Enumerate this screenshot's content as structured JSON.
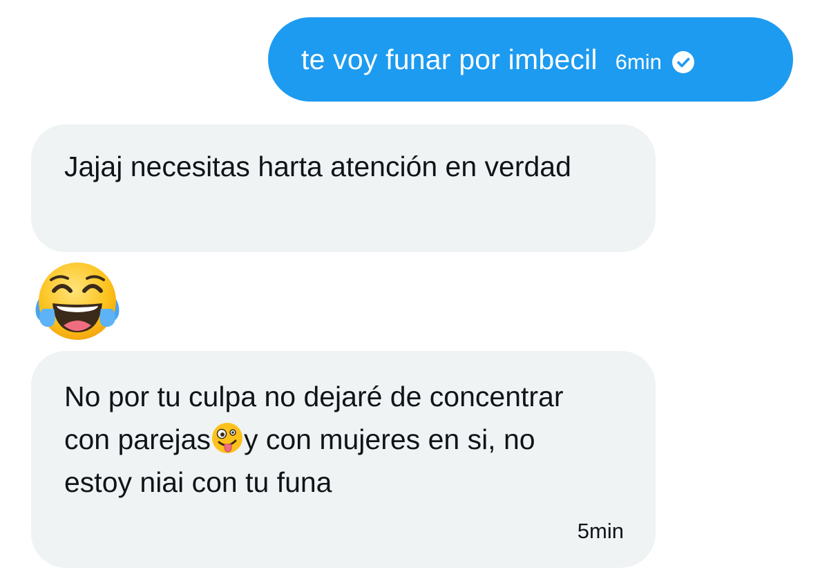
{
  "conversation": {
    "outgoing": [
      {
        "text": "te voy funar por imbecil",
        "time": "6min",
        "status_icon": "read-check-icon"
      }
    ],
    "incoming": [
      {
        "text": "Jajaj necesitas harta atención en verdad"
      },
      {
        "emoji": "😂",
        "emoji_icon": "face-with-tears-of-joy-icon"
      },
      {
        "text_part_1": "No por tu culpa no dejaré de concentrar con parejas",
        "emoji": "🤪",
        "emoji_icon": "zany-face-icon",
        "text_part_2": "y con mujeres en si, no estoy niai con tu funa",
        "time": "5min"
      }
    ]
  },
  "colors": {
    "outgoing_bubble": "#1d9bf0",
    "incoming_bubble": "#eff3f4",
    "text_dark": "#0f1419"
  }
}
